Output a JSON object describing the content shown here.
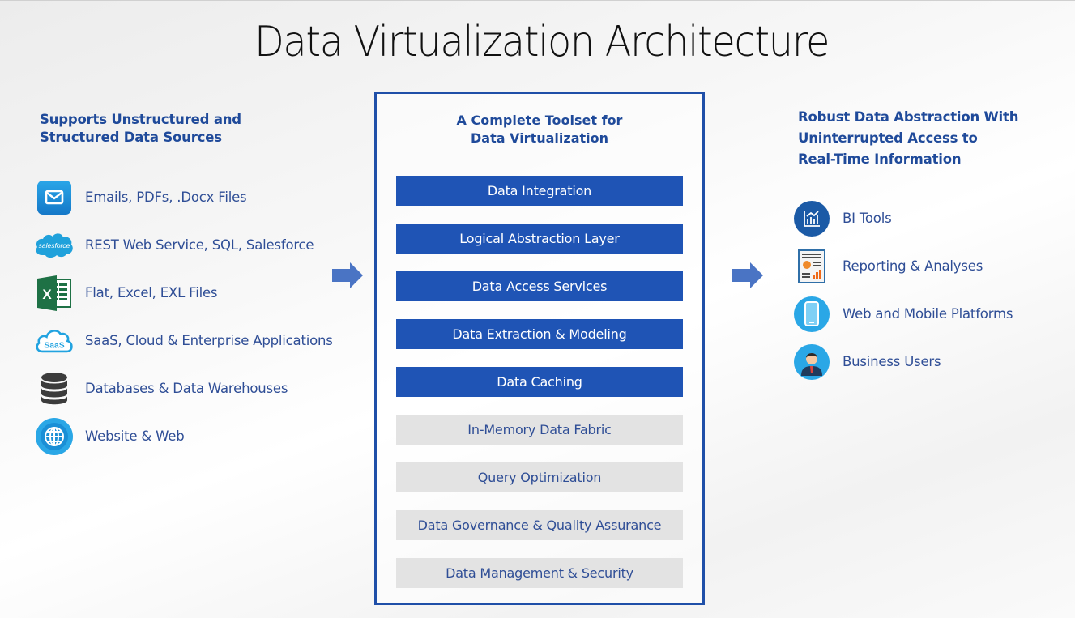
{
  "title": "Data Virtualization Architecture",
  "sources": {
    "heading": [
      "Supports Unstructured and",
      "Structured Data Sources"
    ],
    "items": [
      {
        "icon": "email-icon",
        "label": "Emails, PDFs, .Docx Files"
      },
      {
        "icon": "salesforce-icon",
        "label": "REST Web Service, SQL, Salesforce",
        "icon_text": "salesforce"
      },
      {
        "icon": "excel-icon",
        "label": "Flat, Excel, EXL Files",
        "icon_text": "X"
      },
      {
        "icon": "saas-cloud-icon",
        "label": "SaaS, Cloud & Enterprise Applications",
        "icon_text": "SaaS"
      },
      {
        "icon": "database-icon",
        "label": "Databases & Data Warehouses"
      },
      {
        "icon": "globe-icon",
        "label": "Website & Web"
      }
    ]
  },
  "toolset": {
    "heading": [
      "A Complete Toolset for",
      "Data Virtualization"
    ],
    "layers": [
      {
        "label": "Data Integration",
        "style": "primary"
      },
      {
        "label": "Logical Abstraction Layer",
        "style": "primary"
      },
      {
        "label": "Data Access Services",
        "style": "primary"
      },
      {
        "label": "Data Extraction & Modeling",
        "style": "primary"
      },
      {
        "label": "Data Caching",
        "style": "primary"
      },
      {
        "label": "In-Memory Data Fabric",
        "style": "secondary"
      },
      {
        "label": "Query Optimization",
        "style": "secondary"
      },
      {
        "label": "Data Governance & Quality Assurance",
        "style": "secondary"
      },
      {
        "label": "Data Management & Security",
        "style": "secondary"
      }
    ]
  },
  "consumers": {
    "heading": [
      "Robust Data Abstraction With",
      "Uninterrupted Access to",
      "Real-Time Information"
    ],
    "items": [
      {
        "icon": "bi-chart-icon",
        "label": "BI Tools"
      },
      {
        "icon": "report-icon",
        "label": "Reporting & Analyses"
      },
      {
        "icon": "mobile-icon",
        "label": "Web and Mobile Platforms"
      },
      {
        "icon": "business-user-icon",
        "label": "Business Users"
      }
    ]
  },
  "colors": {
    "primary_blue": "#1f54b5",
    "secondary_gray": "#e3e3e3",
    "heading_blue": "#1f4a9a",
    "text_blue": "#2f4e96",
    "arrow_blue": "#4a74c4"
  }
}
